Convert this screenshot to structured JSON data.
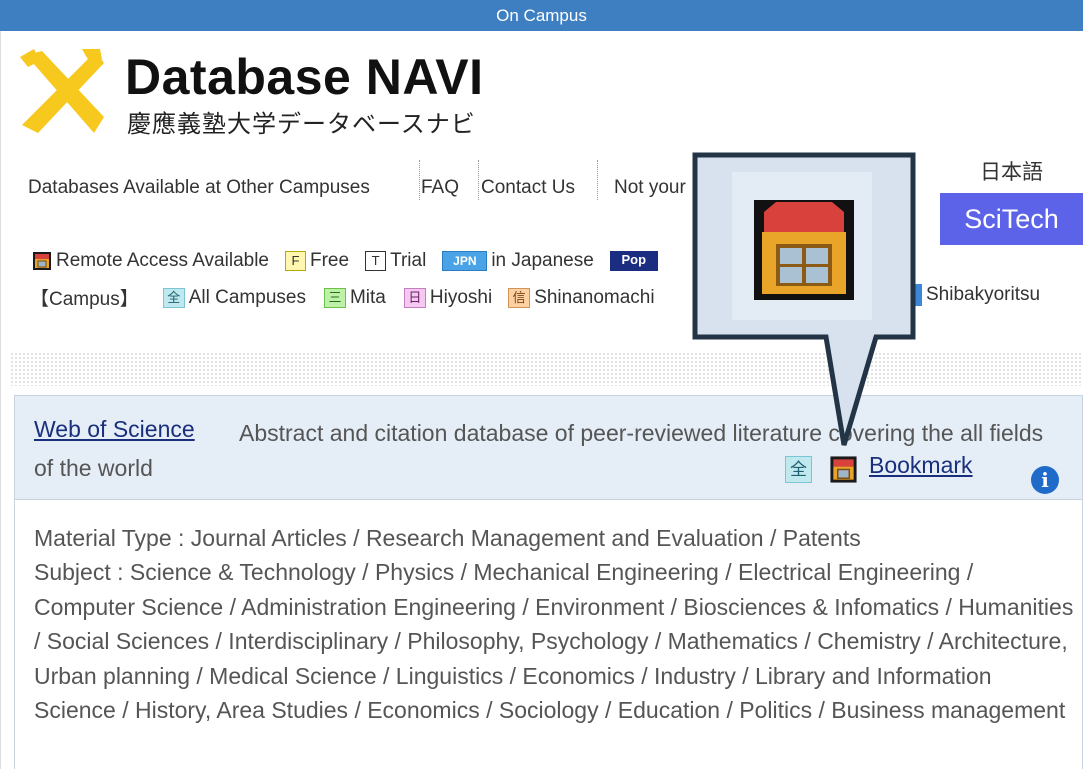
{
  "topbar": {
    "label": "On Campus"
  },
  "logo": {
    "title": "Database NAVI",
    "subtitle": "慶應義塾大学データベースナビ"
  },
  "nav": {
    "items": [
      {
        "label": "Databases Available at Other Campuses"
      },
      {
        "label": "FAQ"
      },
      {
        "label": "Contact Us"
      },
      {
        "label": "Not your"
      }
    ],
    "language": "日本語",
    "scitech": "SciTech"
  },
  "legend": {
    "remote": "Remote Access Available",
    "free_badge": "F",
    "free": "Free",
    "trial_badge": "T",
    "trial": "Trial",
    "jpn_badge": "JPN",
    "japanese": "in Japanese",
    "pop_badge": "Pop"
  },
  "campus": {
    "heading": "【Campus】",
    "all_badge": "全",
    "all": "All Campuses",
    "mita_badge": "三",
    "mita": "Mita",
    "hiyoshi_badge": "日",
    "hiyoshi": "Hiyoshi",
    "shina_badge": "信",
    "shinanomachi": "Shinanomachi",
    "shibakyoritsu": "Shibakyoritsu"
  },
  "entry": {
    "name": "Web of Science",
    "description": "Abstract and citation database of peer-reviewed literature covering the all fields of the world",
    "campus_badge": "全",
    "bookmark": "Bookmark",
    "info": "i",
    "material_type": "Material Type : Journal Articles / Research Management and Evaluation / Patents",
    "subject": "Subject : Science & Technology / Physics / Mechanical Engineering / Electrical Engineering / Computer Science / Administration Engineering / Environment / Biosciences & Infomatics / Humanities / Social Sciences / Interdisciplinary / Philosophy, Psychology / Mathematics / Chemistry / Architecture, Urban planning / Medical Science / Linguistics / Economics / Industry / Library and Information Science / History, Area Studies / Economics / Sociology / Education / Politics / Business management"
  },
  "colors": {
    "topbar": "#3d7fc1",
    "logo_yellow": "#f7c81e",
    "scitech": "#5d63e9",
    "link": "#1a2f7c",
    "entry_bg": "#e5eef7",
    "callout_bg": "#d7e2ee",
    "callout_border": "#233446"
  },
  "icons": [
    "logo-x-icon",
    "remote-access-house-icon",
    "info-icon",
    "bookmark-house-icon"
  ]
}
